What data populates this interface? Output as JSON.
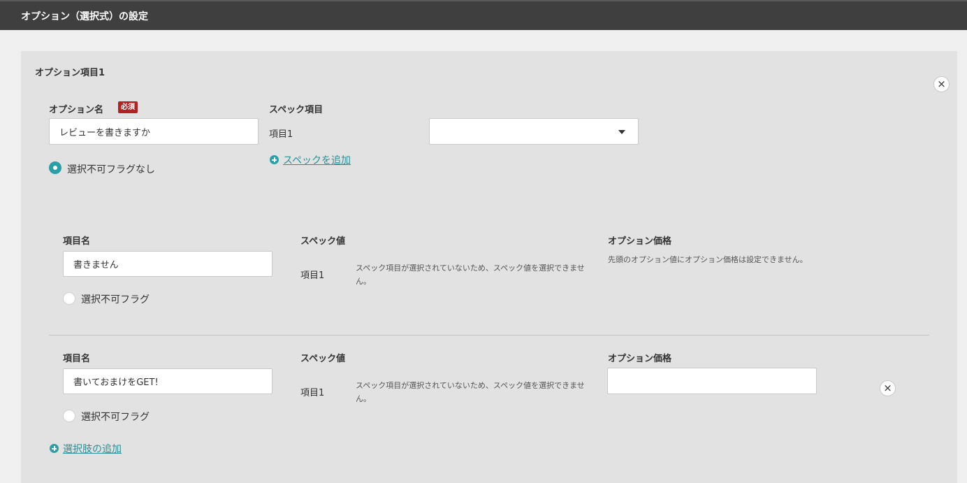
{
  "header": {
    "title": "オプション（選択式）の設定"
  },
  "option": {
    "title": "オプション項目1",
    "name_label": "オプション名",
    "required_badge": "必須",
    "name_value": "レビューを書きますか",
    "flag_label": "選択不可フラグなし",
    "spec_heading": "スペック項目",
    "spec_row_label": "項目1",
    "spec_select_value": "",
    "add_spec_link": "スペックを追加"
  },
  "choices": [
    {
      "item_name_label": "項目名",
      "item_name_value": "書きません",
      "flag_label": "選択不可フラグ",
      "spec_value_label": "スペック値",
      "spec_row_label": "項目1",
      "spec_note": "スペック項目が選択されていないため、スペック値を選択できません。",
      "price_label": "オプション価格",
      "price_note": "先頭のオプション値にオプション価格は設定できません。"
    },
    {
      "item_name_label": "項目名",
      "item_name_value": "書いておまけをGET!",
      "flag_label": "選択不可フラグ",
      "spec_value_label": "スペック値",
      "spec_row_label": "項目1",
      "spec_note": "スペック項目が選択されていないため、スペック値を選択できません。",
      "price_label": "オプション価格",
      "price_value": ""
    }
  ],
  "add_choice_link": "選択肢の追加",
  "icons": {
    "close": "×"
  },
  "colors": {
    "header_bg": "#3f3f3f",
    "accent": "#2a9fa5",
    "required": "#b22222"
  }
}
